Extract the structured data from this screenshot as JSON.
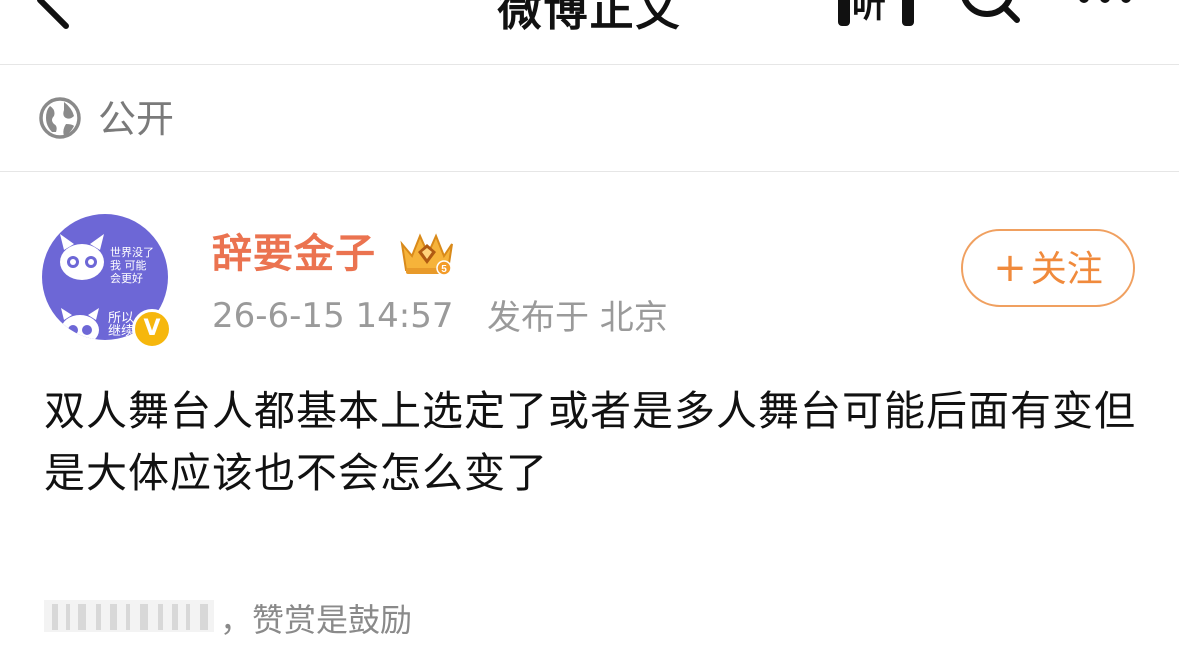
{
  "navbar": {
    "title": "微博正文",
    "listen_label": "听"
  },
  "visibility": {
    "label": "公开"
  },
  "author": {
    "name": "辞要金子",
    "time": "26-6-15 14:57",
    "location": "发布于 北京",
    "avatar_text_top": "世界没了我 可能会更好",
    "avatar_text_bottom": "所以 继续",
    "verified_mark": "V",
    "follow_label": "关注",
    "follow_plus": "+"
  },
  "post": {
    "text": "双人舞台人都基本上选定了或者是多人舞台可能后面有变但是大体应该也不会怎么变了"
  },
  "reward": {
    "text": "，赞赏是鼓励"
  },
  "colors": {
    "username": "#eb7350",
    "follow": "#f08a3c",
    "muted": "#9a9a9a",
    "badge": "#f6b70d",
    "avatar_bg": "#6d67d6"
  }
}
